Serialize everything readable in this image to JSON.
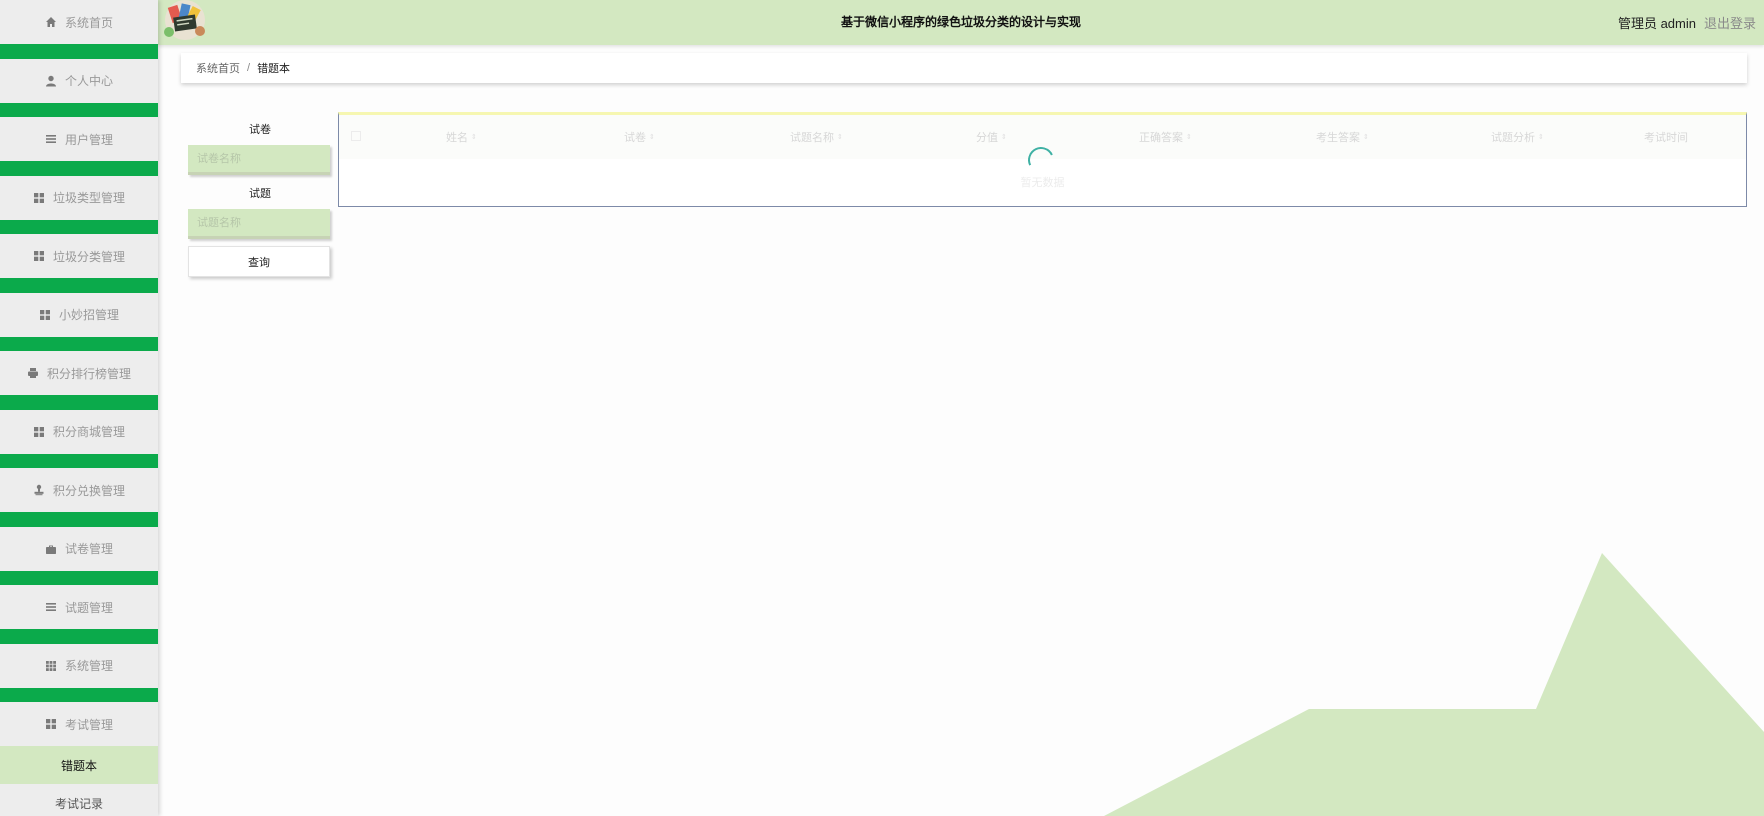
{
  "header": {
    "title": "基于微信小程序的绿色垃圾分类的设计与实现",
    "user": "管理员 admin",
    "logout": "退出登录"
  },
  "sidebar": {
    "items": [
      {
        "label": "系统首页",
        "icon": "home-icon"
      },
      {
        "label": "个人中心",
        "icon": "user-icon"
      },
      {
        "label": "用户管理",
        "icon": "list-icon"
      },
      {
        "label": "垃圾类型管理",
        "icon": "grid-icon"
      },
      {
        "label": "垃圾分类管理",
        "icon": "grid-icon"
      },
      {
        "label": "小妙招管理",
        "icon": "grid-icon"
      },
      {
        "label": "积分排行榜管理",
        "icon": "printer-icon"
      },
      {
        "label": "积分商城管理",
        "icon": "grid-icon"
      },
      {
        "label": "积分兑换管理",
        "icon": "stamp-icon"
      },
      {
        "label": "试卷管理",
        "icon": "briefcase-icon"
      },
      {
        "label": "试题管理",
        "icon": "list-icon"
      },
      {
        "label": "系统管理",
        "icon": "apps-icon"
      },
      {
        "label": "考试管理",
        "icon": "grid-icon"
      }
    ],
    "sub_items": [
      {
        "label": "错题本",
        "active": true
      },
      {
        "label": "考试记录",
        "active": false
      }
    ],
    "accent_color": "#0baa4b"
  },
  "breadcrumb": {
    "home": "系统首页",
    "separator": "/",
    "current": "错题本"
  },
  "search": {
    "paper_label": "试卷",
    "paper_placeholder": "试卷名称",
    "question_label": "试题",
    "question_placeholder": "试题名称",
    "button": "查询"
  },
  "table": {
    "columns": [
      "姓名",
      "试卷",
      "试题名称",
      "分值",
      "正确答案",
      "考生答案",
      "试题分析",
      "考试时间"
    ],
    "empty_text": "暂无数据",
    "loading": true
  },
  "colors": {
    "header_bg": "#d3e8c1",
    "sidebar_bg": "#ededed",
    "spinner": "#3fb1a4"
  }
}
